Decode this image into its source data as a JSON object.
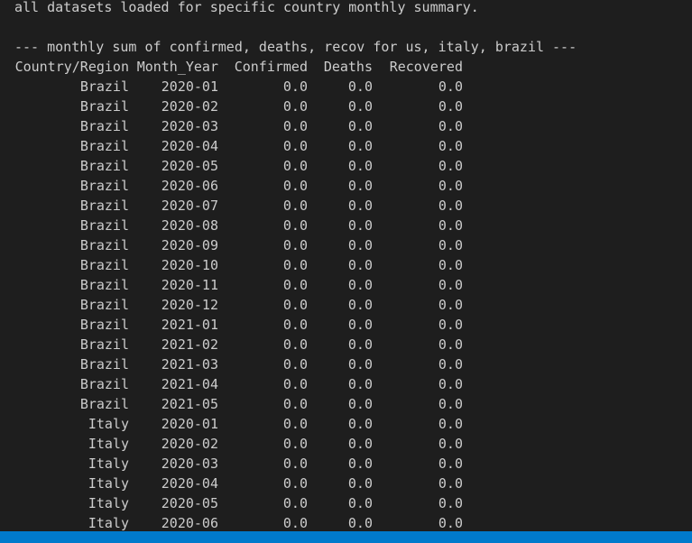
{
  "terminal": {
    "line1": "all datasets loaded for specific country monthly summary.",
    "line2": "--- monthly sum of confirmed, deaths, recov for us, italy, brazil ---"
  },
  "table": {
    "columns": [
      "Country/Region",
      "Month_Year",
      "Confirmed",
      "Deaths",
      "Recovered"
    ],
    "rows": [
      [
        "Brazil",
        "2020-01",
        "0.0",
        "0.0",
        "0.0"
      ],
      [
        "Brazil",
        "2020-02",
        "0.0",
        "0.0",
        "0.0"
      ],
      [
        "Brazil",
        "2020-03",
        "0.0",
        "0.0",
        "0.0"
      ],
      [
        "Brazil",
        "2020-04",
        "0.0",
        "0.0",
        "0.0"
      ],
      [
        "Brazil",
        "2020-05",
        "0.0",
        "0.0",
        "0.0"
      ],
      [
        "Brazil",
        "2020-06",
        "0.0",
        "0.0",
        "0.0"
      ],
      [
        "Brazil",
        "2020-07",
        "0.0",
        "0.0",
        "0.0"
      ],
      [
        "Brazil",
        "2020-08",
        "0.0",
        "0.0",
        "0.0"
      ],
      [
        "Brazil",
        "2020-09",
        "0.0",
        "0.0",
        "0.0"
      ],
      [
        "Brazil",
        "2020-10",
        "0.0",
        "0.0",
        "0.0"
      ],
      [
        "Brazil",
        "2020-11",
        "0.0",
        "0.0",
        "0.0"
      ],
      [
        "Brazil",
        "2020-12",
        "0.0",
        "0.0",
        "0.0"
      ],
      [
        "Brazil",
        "2021-01",
        "0.0",
        "0.0",
        "0.0"
      ],
      [
        "Brazil",
        "2021-02",
        "0.0",
        "0.0",
        "0.0"
      ],
      [
        "Brazil",
        "2021-03",
        "0.0",
        "0.0",
        "0.0"
      ],
      [
        "Brazil",
        "2021-04",
        "0.0",
        "0.0",
        "0.0"
      ],
      [
        "Brazil",
        "2021-05",
        "0.0",
        "0.0",
        "0.0"
      ],
      [
        "Italy",
        "2020-01",
        "0.0",
        "0.0",
        "0.0"
      ],
      [
        "Italy",
        "2020-02",
        "0.0",
        "0.0",
        "0.0"
      ],
      [
        "Italy",
        "2020-03",
        "0.0",
        "0.0",
        "0.0"
      ],
      [
        "Italy",
        "2020-04",
        "0.0",
        "0.0",
        "0.0"
      ],
      [
        "Italy",
        "2020-05",
        "0.0",
        "0.0",
        "0.0"
      ],
      [
        "Italy",
        "2020-06",
        "0.0",
        "0.0",
        "0.0"
      ]
    ]
  },
  "colors": {
    "background": "#1e1e1e",
    "text": "#cccccc",
    "status_bar": "#007acc"
  }
}
